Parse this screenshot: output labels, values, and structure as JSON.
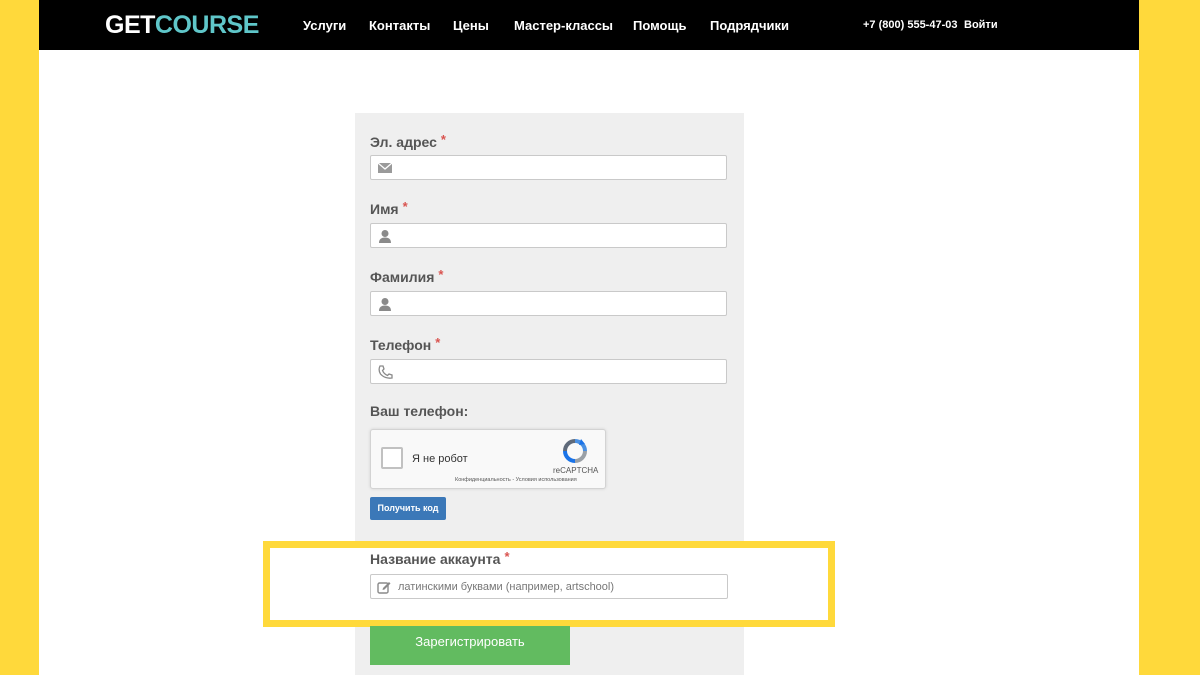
{
  "header": {
    "logo_part1": "GET",
    "logo_part2": "COURSE",
    "nav": [
      "Услуги",
      "Контакты",
      "Цены",
      "Мастер-классы",
      "Помощь",
      "Подрядчики"
    ],
    "phone": "+7 (800) 555-47-03",
    "login": "Войти"
  },
  "form": {
    "required_mark": "*",
    "email_label": "Эл. адрес",
    "email_icon": "envelope-icon",
    "name_label": "Имя",
    "name_icon": "user-icon",
    "surname_label": "Фамилия",
    "surname_icon": "user-icon",
    "phone_label": "Телефон",
    "phone_icon": "phone-icon",
    "your_phone_label": "Ваш телефон:",
    "captcha": {
      "checkbox_label": "Я не робот",
      "brand": "reCAPTCHA",
      "links": "Конфиденциальность - Условия использования"
    },
    "get_code_button": "Получить код",
    "account_label": "Название аккаунта",
    "account_placeholder": "латинскими буквами (например, artschool)",
    "account_icon": "edit-icon",
    "register_button": "Зарегистрировать"
  },
  "colors": {
    "frame": "#ffd93b",
    "navbar": "#000000",
    "logo_accent": "#5fc6c9",
    "panel": "#efefef",
    "required": "#d9534f",
    "code_button": "#3b78b8",
    "register_button": "#62bb60",
    "highlight": "#ffd93b"
  }
}
